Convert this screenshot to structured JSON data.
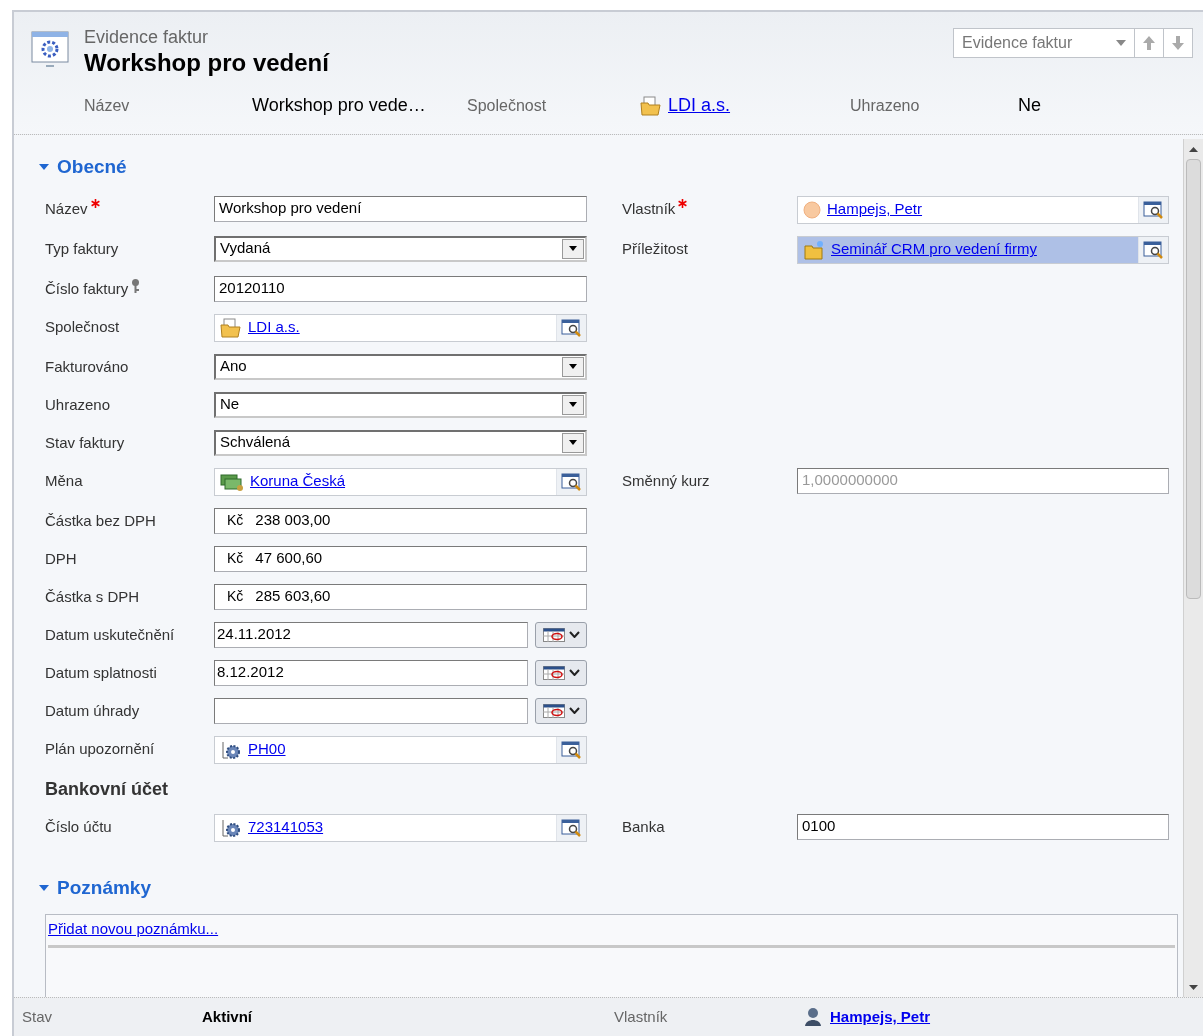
{
  "header": {
    "entity": "Evidence faktur",
    "title": "Workshop pro vedení",
    "form_selector": "Evidence faktur",
    "fields": [
      {
        "label": "Název",
        "kind": "text",
        "value": "Workshop pro vede…"
      },
      {
        "label": "Společnost",
        "kind": "lookup-account",
        "value": "LDI a.s."
      },
      {
        "label": "Uhrazeno",
        "kind": "text",
        "value": "Ne"
      }
    ]
  },
  "sections": [
    {
      "title": "Obecné",
      "expanded": true,
      "rows": [
        {
          "kind": "fields",
          "left": {
            "label": "Název",
            "required": true,
            "kind": "text",
            "value": "Workshop pro vedení"
          },
          "right": {
            "label": "Vlastník",
            "required": true,
            "kind": "lookup-user",
            "value": "Hampejs, Petr",
            "selected": false
          }
        },
        {
          "kind": "fields",
          "left": {
            "label": "Typ faktury",
            "kind": "select",
            "value": "Vydaná"
          },
          "right": {
            "label": "Příležitost",
            "kind": "lookup-opportunity",
            "value": "Seminář CRM pro vedení firmy",
            "selected": true
          }
        },
        {
          "kind": "fields",
          "left": {
            "label": "Číslo faktury",
            "key": true,
            "kind": "text",
            "value": "20120110"
          }
        },
        {
          "kind": "fields",
          "left": {
            "label": "Společnost",
            "kind": "lookup-account",
            "value": "LDI a.s."
          }
        },
        {
          "kind": "fields",
          "left": {
            "label": "Fakturováno",
            "kind": "select",
            "value": "Ano"
          }
        },
        {
          "kind": "fields",
          "left": {
            "label": "Uhrazeno",
            "kind": "select",
            "value": "Ne"
          }
        },
        {
          "kind": "fields",
          "left": {
            "label": "Stav faktury",
            "kind": "select",
            "value": "Schválená"
          }
        },
        {
          "kind": "fields",
          "left": {
            "label": "Měna",
            "kind": "lookup-currency",
            "value": "Koruna Česká"
          },
          "right": {
            "label": "Směnný kurz",
            "kind": "text",
            "value": "1,0000000000",
            "disabled": true
          }
        },
        {
          "kind": "fields",
          "left": {
            "label": "Částka bez DPH",
            "kind": "money",
            "currency": "Kč",
            "value": "238 003,00"
          }
        },
        {
          "kind": "fields",
          "left": {
            "label": "DPH",
            "kind": "money",
            "currency": "Kč",
            "value": "47 600,60"
          }
        },
        {
          "kind": "fields",
          "left": {
            "label": "Částka s DPH",
            "kind": "money",
            "currency": "Kč",
            "value": "285 603,60"
          }
        },
        {
          "kind": "fields",
          "left": {
            "label": "Datum uskutečnění",
            "kind": "date",
            "value": "24.11.2012"
          }
        },
        {
          "kind": "fields",
          "left": {
            "label": "Datum splatnosti",
            "kind": "date",
            "value": "8.12.2012"
          }
        },
        {
          "kind": "fields",
          "left": {
            "label": "Datum úhrady",
            "kind": "date"
          }
        },
        {
          "kind": "fields",
          "left": {
            "label": "Plán upozornění",
            "kind": "lookup-gear",
            "value": "PH00"
          }
        },
        {
          "kind": "heading",
          "text": "Bankovní účet"
        },
        {
          "kind": "fields",
          "left": {
            "label": "Číslo účtu",
            "kind": "lookup-gear",
            "value": "723141053"
          },
          "right": {
            "label": "Banka",
            "kind": "text",
            "value": "0100"
          }
        }
      ]
    },
    {
      "title": "Poznámky",
      "expanded": true,
      "notes_link": "Přidat novou poznámku..."
    }
  ],
  "status_bar": [
    {
      "label": "Stav",
      "kind": "text",
      "value": "Aktivní"
    },
    {
      "label": "Vlastník",
      "kind": "lookup-person",
      "value": "Hampejs, Petr"
    }
  ]
}
